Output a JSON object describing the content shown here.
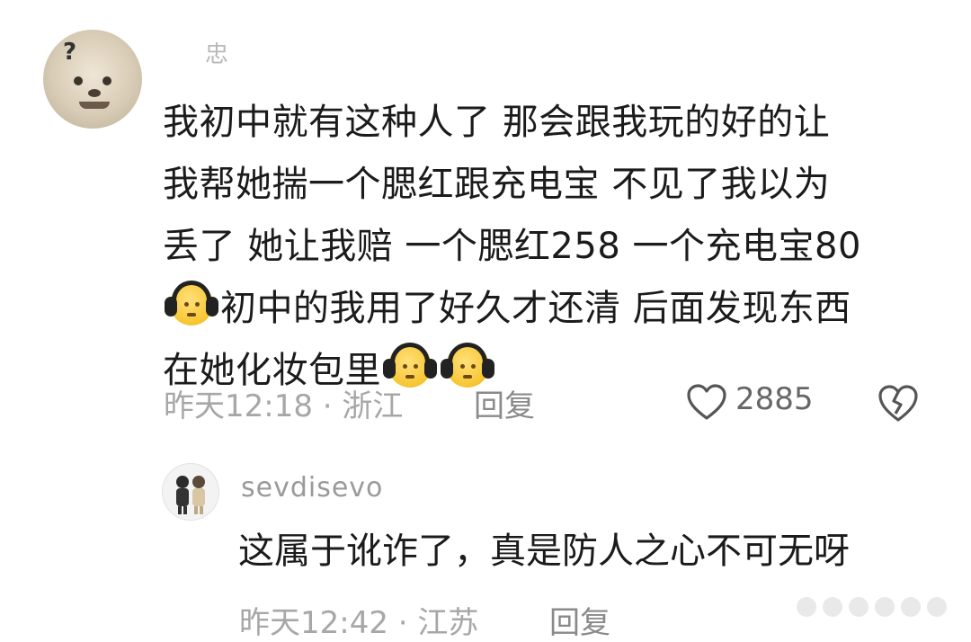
{
  "comment1": {
    "username": "忠",
    "lines": [
      "我初中就有这种人了 那会跟我玩的好的让",
      "我帮她揣一个腮红跟充电宝 不见了我以为",
      "丢了 她让我赔 一个腮红258 一个充电宝80"
    ],
    "line4_text": "初中的我用了好久才还清 后面发现东西",
    "line5_text": "在她化妆包里",
    "emoji_name": "headphones-sad-face-emoji",
    "time": "昨天12:18",
    "location": "浙江",
    "reply_label": "回复",
    "likes": "2885"
  },
  "comment2": {
    "username": "sevdisevo",
    "text": "这属于讹诈了，真是防人之心不可无呀",
    "time": "昨天12:42",
    "location": "江苏",
    "reply_label": "回复"
  },
  "icons": {
    "like": "heart-outline-icon",
    "dislike": "broken-heart-icon"
  },
  "colors": {
    "text": "#1b1b1b",
    "meta": "#a7a7a7",
    "emoji_yellow": "#f7c531"
  }
}
